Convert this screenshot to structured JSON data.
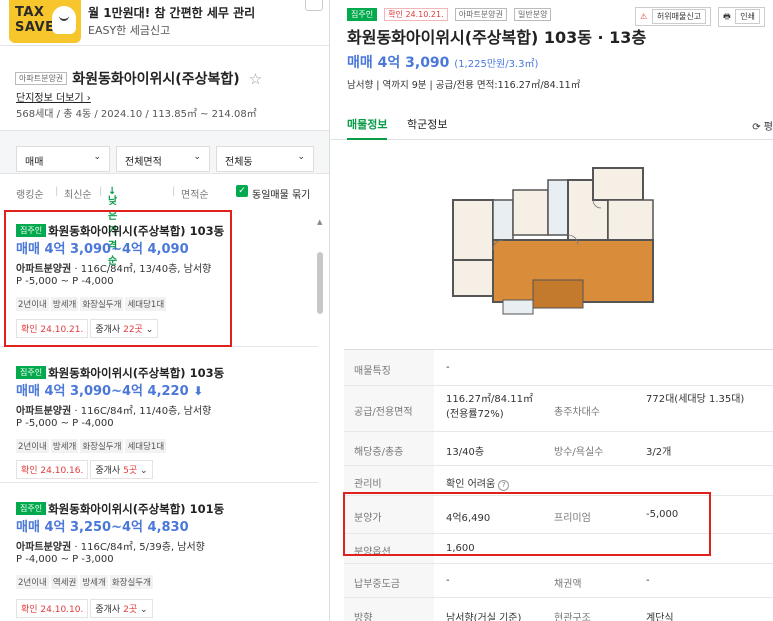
{
  "banner": {
    "logo_line1": "TAX",
    "logo_line2": "SAVE",
    "headline": "월 1만원대! 참 간편한 세무 관리",
    "sub": "EASY한 세금신고"
  },
  "complex": {
    "type_tag": "아파트분양권",
    "name": "화원동화아이위시(주상복합)",
    "link": "단지정보 더보기",
    "summary": "568세대 / 총 4동 / 2024.10 / 113.85㎡ ~ 214.08㎡"
  },
  "filters": {
    "trade": "매매",
    "area": "전체면적",
    "building": "전체동"
  },
  "sort": {
    "opt1": "랭킹순",
    "opt2": "최신순",
    "opt3": "낮은가격순",
    "opt4": "면적순",
    "same_label": "동일매물 묶기"
  },
  "listings": [
    {
      "tag": "집주인",
      "name": "화원동화아이위시(주상복합) 103동",
      "price": "매매 4억 3,090~4억 4,090",
      "d1_type": "아파트분양권",
      "d1_rest": " · 116C/84㎡, 13/40층, 남서향",
      "d2": "P -5,000 ~ P -4,000",
      "tags": [
        "2년이내",
        "방세개",
        "화장실두개",
        "세대당1대"
      ],
      "confirm": "확인 24.10.21.",
      "agents": "중개사",
      "agents_count": "22곳"
    },
    {
      "tag": "집주인",
      "name": "화원동화아이위시(주상복합) 103동",
      "price": "매매 4억 3,090~4억 4,220",
      "d1_type": "아파트분양권",
      "d1_rest": " · 116C/84㎡, 11/40층, 남서향",
      "d2": "P -5,000 ~ P -4,000",
      "tags": [
        "2년이내",
        "방세개",
        "화장실두개",
        "세대당1대"
      ],
      "confirm": "확인 24.10.16.",
      "agents": "중개사",
      "agents_count": "5곳"
    },
    {
      "tag": "집주인",
      "name": "화원동화아이위시(주상복합) 101동",
      "price": "매매 4억 3,250~4억 4,830",
      "d1_type": "아파트분양권",
      "d1_rest": " · 116C/84㎡, 5/39층, 남서향",
      "d2": "P -4,000 ~ P -3,000",
      "tags": [
        "2년이내",
        "역세권",
        "방세개",
        "화장실두개"
      ],
      "confirm": "확인 24.10.10.",
      "agents": "중개사",
      "agents_count": "2곳"
    }
  ],
  "detail": {
    "tag_owner": "집주인",
    "tag_confirm": "확인 24.10.21.",
    "tag_type": "아파트분양권",
    "tag_sale": "일반분양",
    "report": "허위매물신고",
    "print": "인쇄",
    "title": "화원동화아이위시(주상복합) 103동 · 13층",
    "price": "매매 4억 3,090",
    "price_sub": "(1,225만원/3.3㎡)",
    "info": "남서향  |  역까지 9분  |  공급/전용 면적:116.27㎡/84.11㎡",
    "tab1": "매물정보",
    "tab2": "학군정보",
    "refresh": "평",
    "rows": [
      {
        "l": "매물특징",
        "v": "-",
        "l2": "",
        "v2": ""
      },
      {
        "l": "공급/전용면적",
        "v": "116.27㎡/84.11㎡(전용률72%)",
        "l2": "총주차대수",
        "v2": "772대(세대당 1.35대)"
      },
      {
        "l": "해당층/총층",
        "v": "13/40층",
        "l2": "방수/욕실수",
        "v2": "3/2개"
      },
      {
        "l": "관리비",
        "v": "확인 어려움",
        "l2": "",
        "v2": ""
      },
      {
        "l": "분양가",
        "v": "4억6,490",
        "l2": "프리미엄",
        "v2": "-5,000"
      },
      {
        "l": "분양옵션",
        "v": "1,600",
        "l2": "",
        "v2": ""
      },
      {
        "l": "납부중도금",
        "v": "-",
        "l2": "채권액",
        "v2": "-"
      },
      {
        "l": "방향",
        "v": "남서향(거실 기준)",
        "l2": "현관구조",
        "v2": "계단식"
      }
    ]
  },
  "colors": {
    "green": "#03a94d",
    "blue": "#4a78d8",
    "red": "#e0201c",
    "plan_wood": "#d98c3a"
  }
}
